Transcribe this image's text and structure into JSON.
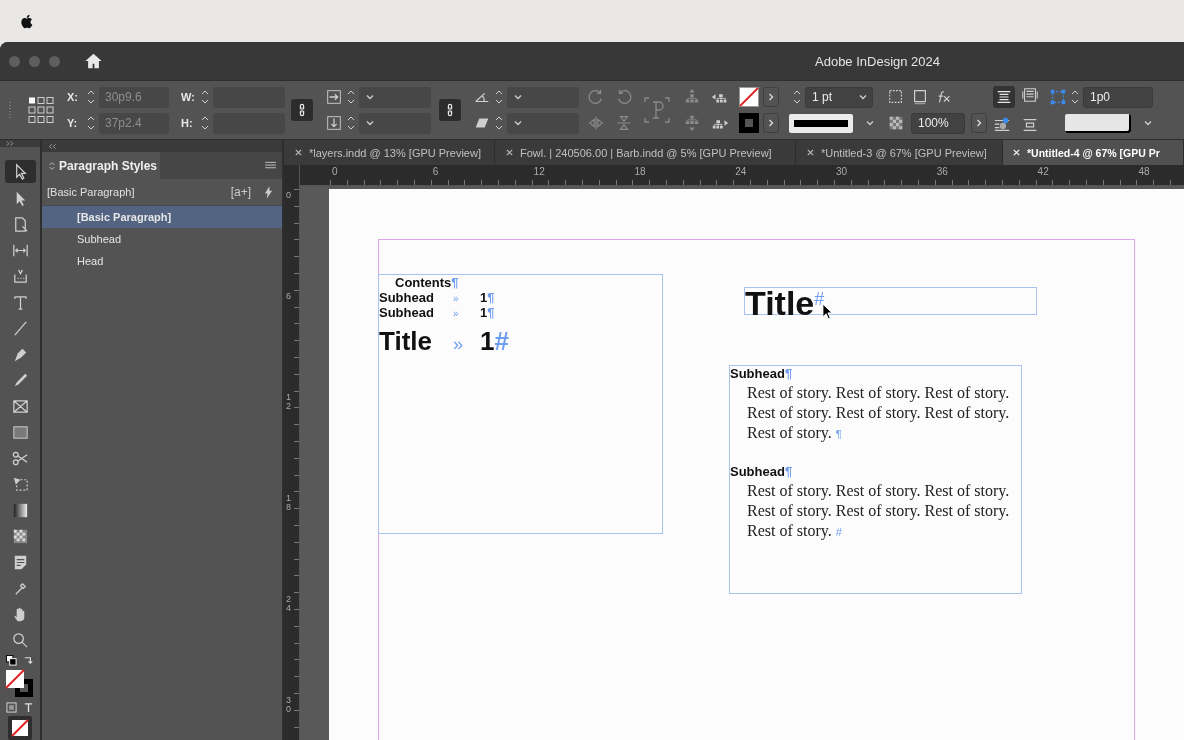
{
  "window": {
    "title": "Adobe InDesign 2024"
  },
  "control_panel": {
    "x": {
      "label": "X:",
      "value": "30p9.6"
    },
    "y": {
      "label": "Y:",
      "value": "37p2.4"
    },
    "w": {
      "label": "W:"
    },
    "h": {
      "label": "H:"
    },
    "stroke_weight": "1 pt",
    "opacity": "100%",
    "offset": "1p0"
  },
  "paragraph_styles": {
    "title": "Paragraph Styles",
    "current_style": "[Basic Paragraph]",
    "new_group_button": "[a+]",
    "items": [
      {
        "label": "[Basic Paragraph]",
        "selected": true
      },
      {
        "label": "Subhead",
        "selected": false
      },
      {
        "label": "Head",
        "selected": false
      }
    ]
  },
  "document_tabs": [
    {
      "label": "*layers.indd @ 13% [GPU Preview]",
      "selected": false
    },
    {
      "label": "Fowl. | 240506.00 | Barb.indd @ 5% [GPU Preview]",
      "selected": false
    },
    {
      "label": "*Untitled-3 @ 67% [GPU Preview]",
      "selected": false
    },
    {
      "label": "*Untitled-4 @ 67% [GPU Pr",
      "selected": true
    }
  ],
  "rulers": {
    "horizontal": [
      "0",
      "6",
      "12",
      "18",
      "24",
      "30",
      "36",
      "42",
      "48"
    ],
    "vertical": [
      "0",
      "6",
      "12",
      "18",
      "24",
      "30"
    ]
  },
  "page": {
    "toc_frame": {
      "heading": "Contents",
      "heading_mark": "¶",
      "entries": [
        {
          "kind": "subhead",
          "text": "Subhead",
          "tab": "»",
          "page": "1",
          "mark": "¶"
        },
        {
          "kind": "subhead",
          "text": "Subhead",
          "tab": "»",
          "page": "1",
          "mark": "¶"
        },
        {
          "kind": "title",
          "text": "Title",
          "tab": "»",
          "page": "1",
          "mark": "#"
        }
      ]
    },
    "title_frame": {
      "text": "Title",
      "mark": "#"
    },
    "story_frame": {
      "sections": [
        {
          "subhead": "Subhead",
          "subhead_mark": "¶",
          "body": "Rest of story. Rest of story. Rest of story. Rest of story. Rest of story. Rest of story. Rest of story.",
          "body_mark": "¶"
        },
        {
          "subhead": "Subhead",
          "subhead_mark": "¶",
          "body": "Rest of story. Rest of story. Rest of story. Rest of story. Rest of story. Rest of story. Rest of story.",
          "body_mark": "#"
        }
      ]
    }
  }
}
